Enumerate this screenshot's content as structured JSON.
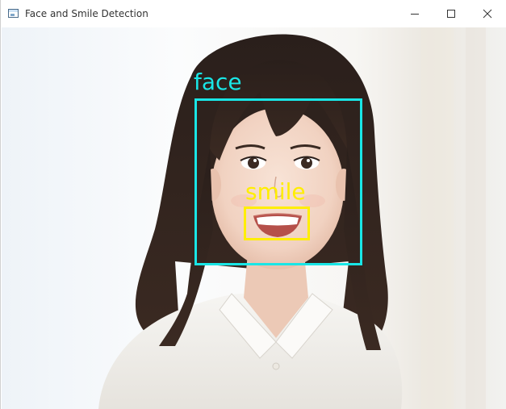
{
  "window": {
    "title": "Face and Smile Detection",
    "icon": "app-window-icon",
    "controls": {
      "minimize_icon": "minimize-icon",
      "maximize_icon": "maximize-icon",
      "close_icon": "close-icon"
    }
  },
  "image_view": {
    "detections": [
      {
        "label": "face",
        "color": "#19e6e6"
      },
      {
        "label": "smile",
        "color": "#ffee00"
      }
    ]
  }
}
